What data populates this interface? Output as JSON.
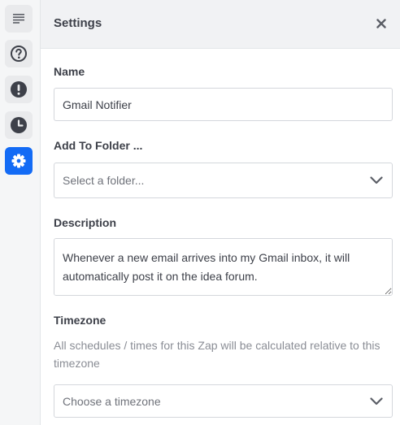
{
  "rail": {
    "items": [
      {
        "icon": "list-icon",
        "label": "Outline"
      },
      {
        "icon": "help-circle-icon",
        "label": "Help"
      },
      {
        "icon": "alert-icon",
        "label": "Alerts"
      },
      {
        "icon": "clock-icon",
        "label": "History"
      },
      {
        "icon": "gear-icon",
        "label": "Settings",
        "active": true
      }
    ],
    "active_color": "#136bf5"
  },
  "panel": {
    "title": "Settings",
    "name": {
      "label": "Name",
      "value": "Gmail Notifier"
    },
    "folder": {
      "label": "Add To Folder ...",
      "placeholder": "Select a folder..."
    },
    "description": {
      "label": "Description",
      "value": "Whenever a new email arrives into my Gmail inbox, it will automatically post it on the idea forum."
    },
    "timezone": {
      "label": "Timezone",
      "help": "All schedules / times for this Zap will be calculated relative to this timezone",
      "placeholder": "Choose a timezone"
    }
  }
}
